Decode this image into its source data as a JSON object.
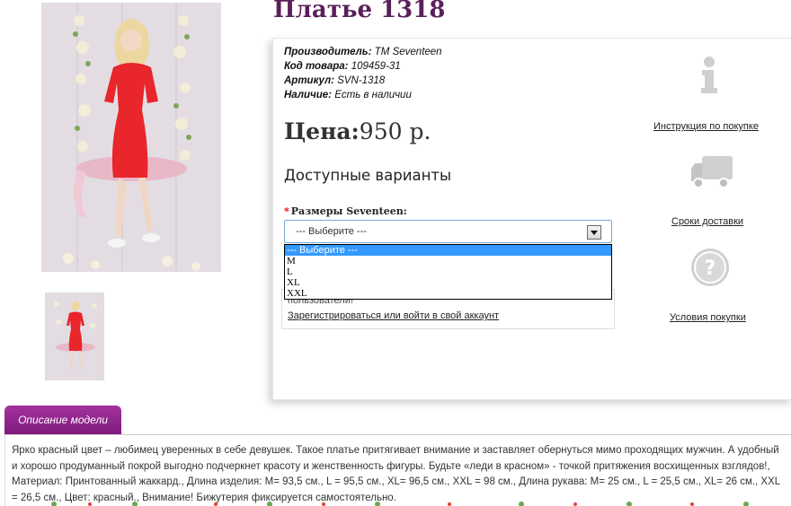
{
  "product": {
    "title": "Платье 1318"
  },
  "meta": {
    "manufacturer_label": "Производитель:",
    "manufacturer_value": "ТМ Seventeen",
    "code_label": "Код товара:",
    "code_value": "109459-31",
    "article_label": "Артикул:",
    "article_value": "SVN-1318",
    "stock_label": "Наличие:",
    "stock_value": "Есть в наличии"
  },
  "price": {
    "label": "Цена:",
    "value": "950 р."
  },
  "variants": {
    "heading": "Доступные варианты",
    "required_mark": "*",
    "size_label": "Размеры Seventeen:",
    "selected": "--- Выберите ---",
    "options": [
      "--- Выберите ---",
      "M",
      "L",
      "XL",
      "XXL"
    ]
  },
  "guest": {
    "text": "пользователи!",
    "register_link": "Зарегистрироваться или войти в свой аккаунт"
  },
  "sidebar": {
    "instruction_link": "Инструкция по покупке",
    "delivery_link": "Сроки доставки",
    "terms_link": "Условия покупки"
  },
  "tabs": {
    "description_tab": "Описание модели"
  },
  "description": {
    "text": "Ярко красный цвет – любимец уверенных в себе девушек. Такое платье притягивает внимание и заставляет обернуться мимо проходящих мужчин. А удобный и хорошо продуманный покрой выгодно подчеркнет красоту и женственность фигуры. Будьте «леди в красном» - точкой притяжения восхищенных взглядов!, Материал: Принтованный жаккард., Длина изделия: M= 93,5 см., L = 95,5 см., XL= 96,5 см., XXL = 98 см., Длина рукава: M= 25 см., L = 25,5 см., XL= 26 см., XXL = 26,5 см., Цвет: красный., Внимание! Бижутерия фиксируется самостоятельно."
  },
  "colors": {
    "title": "#5b1f5a",
    "tab": "#8e2489",
    "select_border": "#7aa7d6",
    "selected_option": "#3399ff",
    "dress": "#e8262b"
  },
  "icons": {
    "info": "info-icon",
    "truck": "truck-icon",
    "question": "question-icon"
  }
}
